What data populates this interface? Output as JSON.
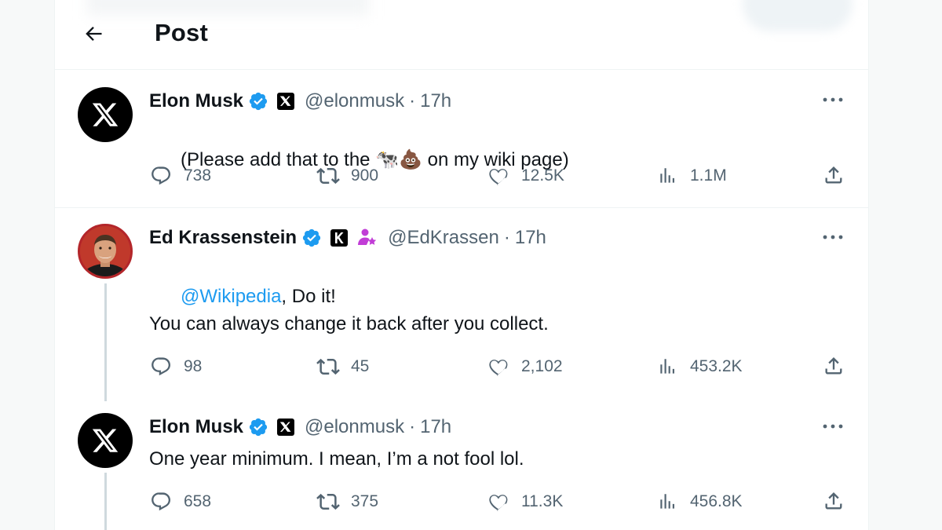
{
  "header": {
    "title": "Post"
  },
  "colors": {
    "accent": "#1d9bf0",
    "muted": "#536471",
    "text": "#0f1419",
    "thread_line": "#cfd9de"
  },
  "posts": [
    {
      "name": "Elon Musk",
      "handle": "@elonmusk",
      "separator": "·",
      "time": "17h",
      "avatar_icon": "x-logo-icon",
      "affiliation_icon": "x-badge-icon",
      "text_before": "(Please add that to the ",
      "emoji": "🐄💩",
      "text_after": " on my wiki page)",
      "replies": "738",
      "reposts": "900",
      "likes": "12.5K",
      "views": "1.1M"
    },
    {
      "name": "Ed Krassenstein",
      "handle": "@EdKrassen",
      "separator": "·",
      "time": "17h",
      "avatar_icon": "person-avatar",
      "affiliation_icon": "k-badge-icon",
      "extra_icon": "subscriber-person-star-icon",
      "mention": "@Wikipedia",
      "text_line1_rest": ", Do it!",
      "text_line2": "You can always change it back after you collect.",
      "replies": "98",
      "reposts": "45",
      "likes": "2,102",
      "views": "453.2K"
    },
    {
      "name": "Elon Musk",
      "handle": "@elonmusk",
      "separator": "·",
      "time": "17h",
      "avatar_icon": "x-logo-icon",
      "affiliation_icon": "x-badge-icon",
      "text": "One year minimum. I mean, I’m a not fool lol.",
      "replies": "658",
      "reposts": "375",
      "likes": "11.3K",
      "views": "456.8K"
    }
  ]
}
